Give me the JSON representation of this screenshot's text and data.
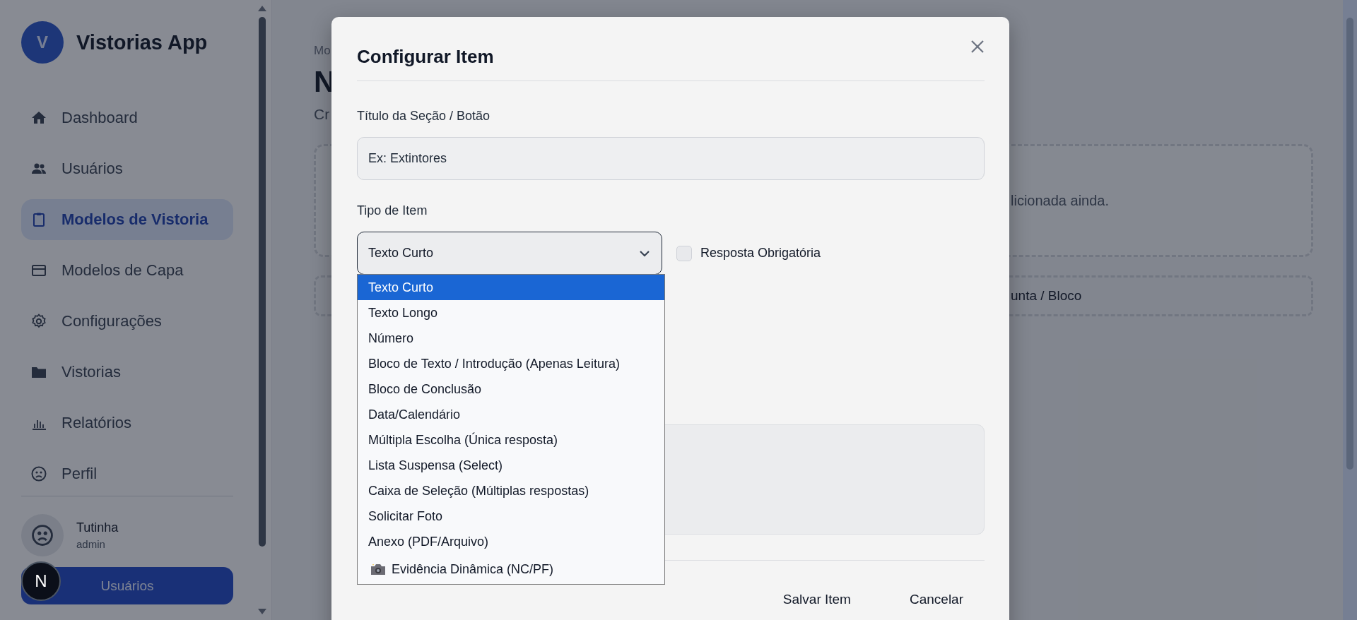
{
  "sidebar": {
    "logo_letter": "V",
    "app_name": "Vistorias App",
    "items": [
      {
        "label": "Dashboard",
        "selected": false
      },
      {
        "label": "Usuários",
        "selected": false
      },
      {
        "label": "Modelos de Vistoria",
        "selected": true
      },
      {
        "label": "Modelos de Capa",
        "selected": false
      },
      {
        "label": "Configurações",
        "selected": false
      },
      {
        "label": "Vistorias",
        "selected": false
      },
      {
        "label": "Relatórios",
        "selected": false
      },
      {
        "label": "Perfil",
        "selected": false
      }
    ],
    "user": {
      "name": "Tutinha",
      "role": "admin"
    },
    "button": "Usuários"
  },
  "dev_badge": "N",
  "page": {
    "breadcrumb": "Mo",
    "title": "N",
    "subtitle": "Cr",
    "empty_message": "licionada ainda.",
    "add_button": "unta / Bloco"
  },
  "modal": {
    "title": "Configurar Item",
    "title_label": "Título da Seção / Botão",
    "title_placeholder": "Ex: Extintores",
    "type_label": "Tipo de Item",
    "type_value": "Texto Curto",
    "required": {
      "label": "Resposta Obrigatória",
      "checked": false
    },
    "options": [
      {
        "label": "Texto Curto",
        "selected": true,
        "kind": "plain"
      },
      {
        "label": "Texto Longo",
        "selected": false,
        "kind": "plain"
      },
      {
        "label": "Número",
        "selected": false,
        "kind": "plain"
      },
      {
        "label": "Bloco de Texto / Introdução (Apenas Leitura)",
        "selected": false,
        "kind": "plain"
      },
      {
        "label": "Bloco de Conclusão",
        "selected": false,
        "kind": "plain"
      },
      {
        "label": "Data/Calendário",
        "selected": false,
        "kind": "plain"
      },
      {
        "label": "Múltipla Escolha (Única resposta)",
        "selected": false,
        "kind": "plain"
      },
      {
        "label": "Lista Suspensa (Select)",
        "selected": false,
        "kind": "plain"
      },
      {
        "label": "Caixa de Seleção (Múltiplas respostas)",
        "selected": false,
        "kind": "plain"
      },
      {
        "label": "Solicitar Foto",
        "selected": false,
        "kind": "plain"
      },
      {
        "label": "Anexo (PDF/Arquivo)",
        "selected": false,
        "kind": "plain"
      },
      {
        "label": "Evidência Dinâmica (NC/PF)",
        "selected": false,
        "kind": "camera"
      }
    ],
    "buttons": [
      "Salvar Item",
      "Cancelar"
    ]
  }
}
